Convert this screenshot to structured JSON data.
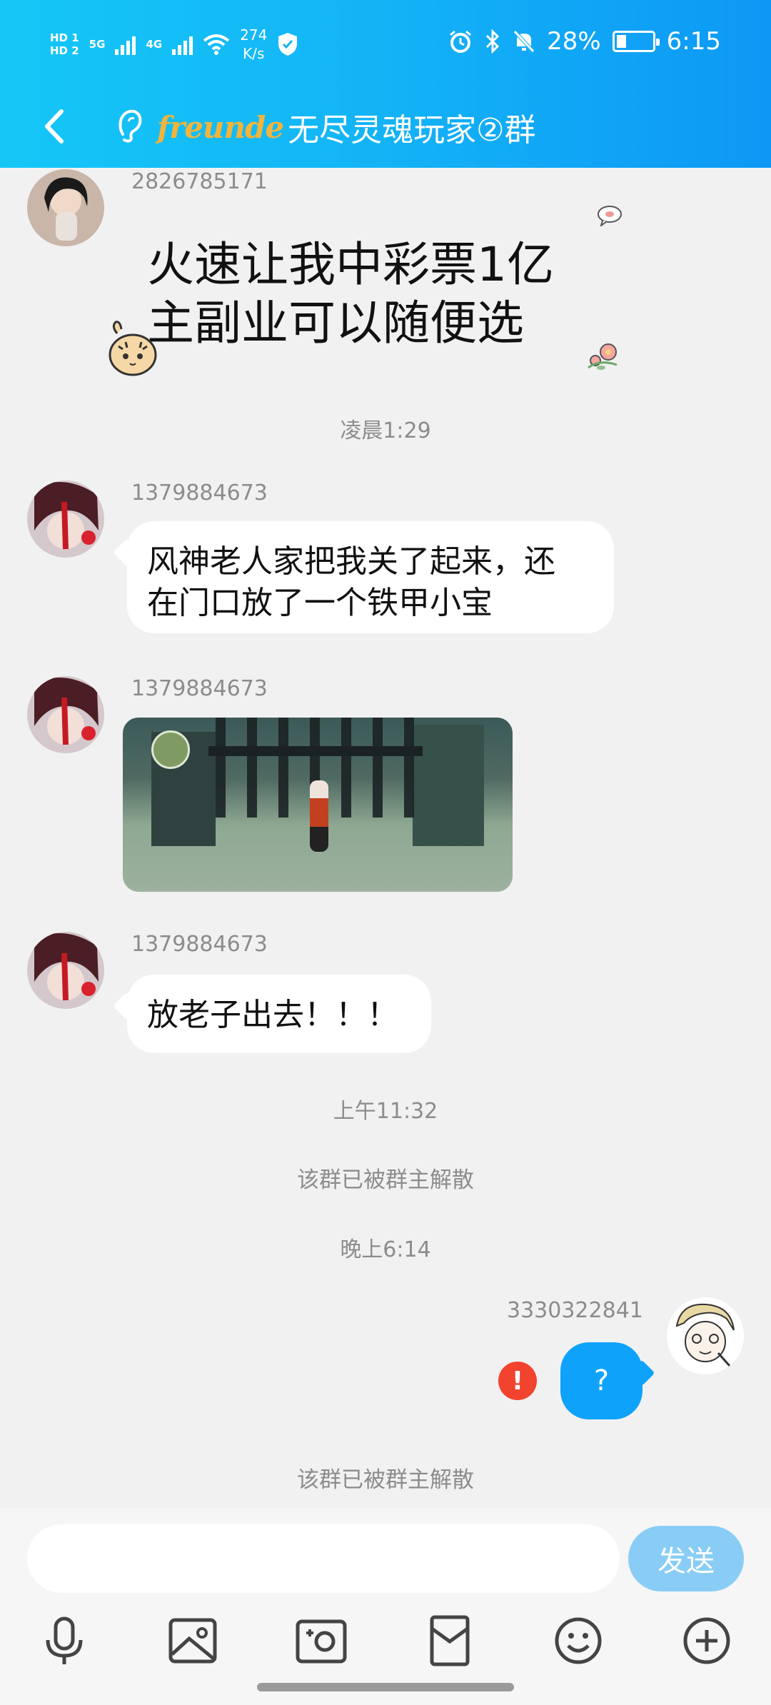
{
  "status_bar": {
    "network_speed_value": "274",
    "network_speed_unit": "K/s",
    "sim1": "HD 1",
    "sim2": "HD 2",
    "sig1_label": "5G",
    "sig2_label": "4G",
    "battery": "28%",
    "battery_level": 0.28,
    "time": "6:15"
  },
  "header": {
    "brand_logo_text": "freunde",
    "group_name": "无尽灵魂玩家②群"
  },
  "messages": [
    {
      "sender": "2826785171",
      "text_line1": "火速让我中彩票1亿",
      "text_line2": "主副业可以随便选"
    },
    {
      "timestamp": "凌晨1:29"
    },
    {
      "sender": "1379884673",
      "text_line1": "风神老人家把我关了起来，还",
      "text_line2": "在门口放了一个铁甲小宝"
    },
    {
      "sender": "1379884673",
      "type": "image"
    },
    {
      "sender": "1379884673",
      "text": "放老子出去！！！"
    },
    {
      "timestamp": "上午11:32"
    },
    {
      "system": "该群已被群主解散"
    },
    {
      "timestamp": "晚上6:14"
    },
    {
      "sender": "3330322841",
      "text": "?",
      "status": "failed"
    },
    {
      "system": "该群已被群主解散"
    }
  ],
  "composer": {
    "send_label": "发送"
  },
  "toolbar": [
    "mic-icon",
    "image-icon",
    "camera-icon",
    "red-packet-icon",
    "emoji-icon",
    "plus-icon"
  ]
}
